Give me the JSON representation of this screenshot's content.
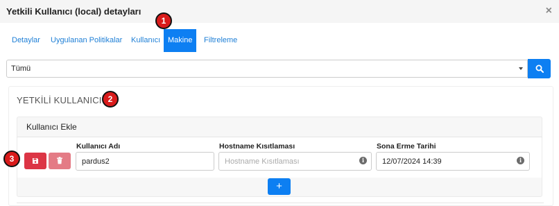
{
  "modal": {
    "title": "Yetkili Kullanıcı (local) detayları",
    "close_symbol": "×"
  },
  "tabs": [
    {
      "label": "Detaylar"
    },
    {
      "label": "Uygulanan Politikalar"
    },
    {
      "label": "Kullanıcı"
    },
    {
      "label": "Makine",
      "active": true
    },
    {
      "label": "Filtreleme"
    }
  ],
  "filter": {
    "selected": "Tümü",
    "search_icon": "search-icon"
  },
  "section": {
    "title": "YETKİLİ KULLANICI"
  },
  "card": {
    "title": "Kullanıcı Ekle",
    "fields": {
      "username": {
        "label": "Kullanıcı Adı",
        "value": "pardus2"
      },
      "hostname": {
        "label": "Hostname Kısıtlaması",
        "placeholder": "Hostname Kısıtlaması"
      },
      "expiry": {
        "label": "Sona Erme Tarihi",
        "value": "12/07/2024 14:39"
      }
    },
    "add_symbol": "+"
  },
  "markers": [
    "1",
    "2",
    "3"
  ],
  "colors": {
    "primary": "#0d7ff2",
    "danger": "#dc3545",
    "marker": "#d91b1b"
  }
}
